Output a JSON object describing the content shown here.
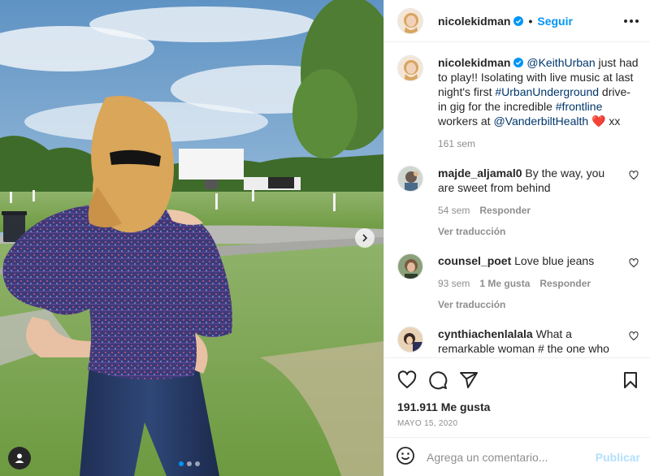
{
  "post": {
    "username": "nicolekidman",
    "separator": "•",
    "follow_label": "Seguir",
    "image_alt": "Woman in purple off-shoulder blouse at drive-in theater"
  },
  "caption": {
    "username": "nicolekidman",
    "mention": "@KeithUrban",
    "text1": " just had to play!! Isolating with live music at last night's first ",
    "hashtag1": "#UrbanUnderground",
    "text2": " drive-in gig for the incredible ",
    "hashtag2": "#frontline",
    "text3": " workers at ",
    "mention2": "@VanderbiltHealth",
    "heart": "❤️",
    "text4": " xx",
    "time": "161 sem"
  },
  "comments": [
    {
      "username": "majde_aljamal0",
      "text": " By the way, you are sweet from behind",
      "time": "54 sem",
      "likes": "",
      "reply": "Responder",
      "translate": "Ver traducción"
    },
    {
      "username": "counsel_poet",
      "text": " Love blue jeans",
      "time": "93 sem",
      "likes": "1 Me gusta",
      "reply": "Responder",
      "translate": "Ver traducción"
    },
    {
      "username": "cynthiachenlalala",
      "text": " What a remarkable woman # the one who",
      "time": "",
      "likes": "",
      "reply": "",
      "translate": ""
    }
  ],
  "stats": {
    "likes": "191.911 Me gusta",
    "date": "MAYO 15, 2020"
  },
  "composer": {
    "placeholder": "Agrega un comentario...",
    "publish_label": "Publicar"
  },
  "colors": {
    "accent": "#0095f6",
    "link": "#00376b",
    "heart": "#ed4956",
    "muted": "#8e8e8e"
  },
  "carousel": {
    "count": 3,
    "active": 1
  }
}
